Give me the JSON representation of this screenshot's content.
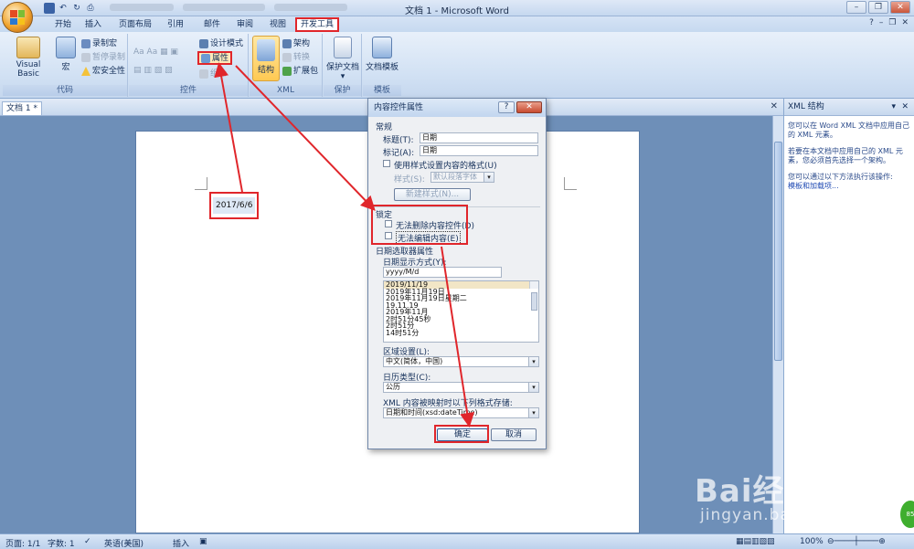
{
  "window": {
    "title": "文档 1 - Microsoft Word"
  },
  "tabs": [
    "开始",
    "插入",
    "页面布局",
    "引用",
    "邮件",
    "审阅",
    "视图",
    "开发工具"
  ],
  "ribbon": {
    "code": {
      "label": "代码",
      "visual_basic": "Visual Basic",
      "macro": "宏",
      "record": "录制宏",
      "pause": "暂停录制",
      "security": "宏安全性"
    },
    "controls": {
      "label": "控件",
      "design_mode": "设计模式",
      "properties": "属性",
      "group": "组合"
    },
    "xml": {
      "label": "XML",
      "structure": "结构",
      "schema": "架构",
      "transform": "转换",
      "expansion": "扩展包"
    },
    "protect": {
      "label": "保护",
      "protect_doc": "保护文档"
    },
    "templates": {
      "label": "模板",
      "doc_template": "文档模板"
    }
  },
  "document": {
    "tab_label": "文档 1 *",
    "date_text": "2017/6/6"
  },
  "xml_pane": {
    "title": "XML 结构",
    "p1": "您可以在 Word XML 文档中应用自己的 XML 元素。",
    "p2": "若要在本文档中应用自己的 XML 元素，您必须首先选择一个架构。",
    "p3": "您可以通过以下方法执行该操作:",
    "link": "模板和加载项..."
  },
  "dialog": {
    "title": "内容控件属性",
    "help": "?",
    "close": "✕",
    "general": "常规",
    "title_label": "标题(T):",
    "title_value": "日期",
    "tag_label": "标记(A):",
    "tag_value": "日期",
    "use_style": "使用样式设置内容的格式(U)",
    "style_label": "样式(S):",
    "style_value": "默认段落字体",
    "new_style": "新建样式(N)...",
    "lock": "锁定",
    "no_delete": "无法删除内容控件(D)",
    "no_edit": "无法编辑内容(E)",
    "date_picker": "日期选取器属性",
    "display_label": "日期显示方式(Y):",
    "display_value": "yyyy/M/d",
    "formats": [
      "2019/11/19",
      "2019年11月19日",
      "2019年11月19日星期二",
      "19.11.19",
      "2019年11月",
      "2时51分45秒",
      "2时51分",
      "14时51分"
    ],
    "locale_label": "区域设置(L):",
    "locale_value": "中文(简体，中国)",
    "calendar_label": "日历类型(C):",
    "calendar_value": "公历",
    "xml_store_label": "XML 内容被映射时以下列格式存储:",
    "xml_store_value": "日期和时间(xsd:dateTime)",
    "ok": "确定",
    "cancel": "取消"
  },
  "statusbar": {
    "page": "页面: 1/1",
    "words": "字数: 1",
    "lang": "英语(美国)",
    "mode": "插入",
    "zoom": "100%"
  },
  "watermark": {
    "brand": "Bai经验",
    "url": "jingyan.baidu.com"
  }
}
